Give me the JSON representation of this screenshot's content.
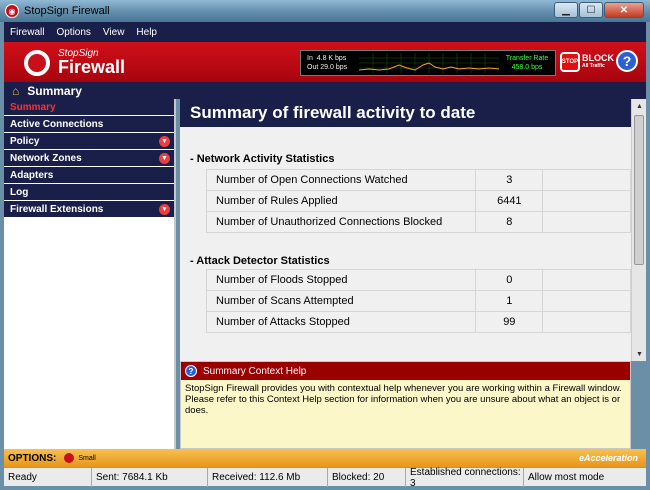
{
  "window": {
    "title": "StopSign Firewall"
  },
  "menu": [
    "Firewall",
    "Options",
    "View",
    "Help"
  ],
  "banner": {
    "logo_sub": "StopSign",
    "logo_main": "Firewall",
    "traffic": {
      "in_label": "In",
      "in_value": "4.8 K bps",
      "out_label": "Out",
      "out_value": "29.0 bps",
      "transfer_label": "Transfer Rate",
      "transfer_value": "458.0 bps"
    },
    "block_label": "BLOCK",
    "block_sub": "All Traffic",
    "stop_icon_text": "STOP"
  },
  "section": {
    "title": "Summary"
  },
  "sidebar": {
    "items": [
      {
        "label": "Summary",
        "active": true,
        "expandable": false
      },
      {
        "label": "Active Connections",
        "active": false,
        "expandable": false
      },
      {
        "label": "Policy",
        "active": false,
        "expandable": true
      },
      {
        "label": "Network Zones",
        "active": false,
        "expandable": true
      },
      {
        "label": "Adapters",
        "active": false,
        "expandable": false
      },
      {
        "label": "Log",
        "active": false,
        "expandable": false
      },
      {
        "label": "Firewall Extensions",
        "active": false,
        "expandable": true
      }
    ]
  },
  "main": {
    "heading": "Summary of firewall activity to date",
    "network": {
      "title": "- Network Activity Statistics",
      "rows": [
        {
          "label": "Number of Open Connections Watched",
          "value": "3"
        },
        {
          "label": "Number of Rules Applied",
          "value": "6441"
        },
        {
          "label": "Number of Unauthorized Connections Blocked",
          "value": "8"
        }
      ]
    },
    "attack": {
      "title": "- Attack Detector Statistics",
      "rows": [
        {
          "label": "Number of Floods Stopped",
          "value": "0"
        },
        {
          "label": "Number of Scans Attempted",
          "value": "1"
        },
        {
          "label": "Number of Attacks Stopped",
          "value": "99"
        }
      ]
    }
  },
  "help": {
    "title": "Summary Context Help",
    "body": "StopSign Firewall provides you with contextual help whenever you are working within a Firewall window. Please refer to this Context Help section for information when you are unsure about what an object is or does."
  },
  "options": {
    "label": "OPTIONS:",
    "small_label": "Small",
    "brand": "eAcceleration"
  },
  "status": {
    "ready": "Ready",
    "sent": "Sent: 7684.1 Kb",
    "received": "Received: 112.6 Mb",
    "blocked": "Blocked: 20",
    "established": "Established connections: 3",
    "mode": "Allow most mode"
  },
  "colors": {
    "navy": "#1a1f4a",
    "red": "#c8101a",
    "help_bg": "#fbf7c8",
    "options_bg": "#f0a830"
  }
}
